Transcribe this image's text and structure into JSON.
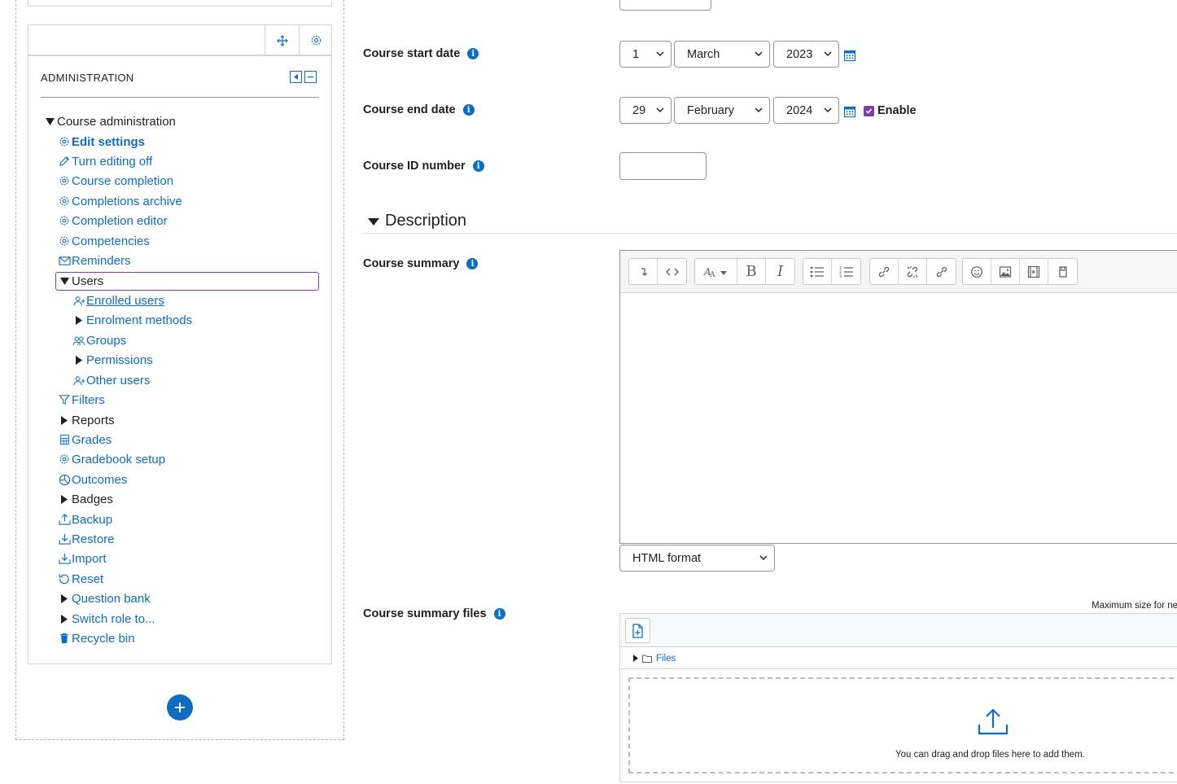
{
  "sidebar": {
    "block_title": "ADMINISTRATION",
    "items": [
      {
        "label": "Course administration",
        "kind": "expanded-plain"
      },
      {
        "label": "Edit settings",
        "kind": "link-bold",
        "icon": "gear-icon"
      },
      {
        "label": "Turn editing off",
        "kind": "link",
        "icon": "pencil-icon"
      },
      {
        "label": "Course completion",
        "kind": "link",
        "icon": "gear-icon"
      },
      {
        "label": "Completions archive",
        "kind": "link",
        "icon": "gear-icon"
      },
      {
        "label": "Completion editor",
        "kind": "link",
        "icon": "gear-icon"
      },
      {
        "label": "Competencies",
        "kind": "link",
        "icon": "gear-icon"
      },
      {
        "label": "Reminders",
        "kind": "link",
        "icon": "envelope-icon"
      },
      {
        "label": "Users",
        "kind": "expanded-plain"
      },
      {
        "label": "Enrolled users",
        "kind": "link-underline",
        "icon": "user-plus-icon"
      },
      {
        "label": "Enrolment methods",
        "kind": "collapsed-link"
      },
      {
        "label": "Groups",
        "kind": "link",
        "icon": "users-icon"
      },
      {
        "label": "Permissions",
        "kind": "collapsed-link"
      },
      {
        "label": "Other users",
        "kind": "link",
        "icon": "user-plus-icon"
      },
      {
        "label": "Filters",
        "kind": "link",
        "icon": "filter-icon"
      },
      {
        "label": "Reports",
        "kind": "collapsed-plain"
      },
      {
        "label": "Grades",
        "kind": "link",
        "icon": "table-icon"
      },
      {
        "label": "Gradebook setup",
        "kind": "link",
        "icon": "gear-icon"
      },
      {
        "label": "Outcomes",
        "kind": "link",
        "icon": "pie-chart-icon"
      },
      {
        "label": "Badges",
        "kind": "collapsed-plain"
      },
      {
        "label": "Backup",
        "kind": "link",
        "icon": "upload-icon"
      },
      {
        "label": "Restore",
        "kind": "link",
        "icon": "download-icon"
      },
      {
        "label": "Import",
        "kind": "link",
        "icon": "download-icon"
      },
      {
        "label": "Reset",
        "kind": "link",
        "icon": "refresh-icon"
      },
      {
        "label": "Question bank",
        "kind": "collapsed-link"
      },
      {
        "label": "Switch role to...",
        "kind": "collapsed-link"
      },
      {
        "label": "Recycle bin",
        "kind": "link",
        "icon": "trash-icon"
      }
    ]
  },
  "form": {
    "start_date": {
      "label": "Course start date",
      "day": "1",
      "month": "March",
      "year": "2023"
    },
    "end_date": {
      "label": "Course end date",
      "day": "29",
      "month": "February",
      "year": "2024",
      "enable_label": "Enable",
      "enabled": true
    },
    "id_number": {
      "label": "Course ID number",
      "value": ""
    },
    "description_section": "Description",
    "summary": {
      "label": "Course summary",
      "format": "HTML format"
    },
    "summary_files": {
      "label": "Course summary files",
      "max_size_text": "Maximum size for ne",
      "path_label": "Files",
      "drop_text": "You can drag and drop files here to add them."
    }
  },
  "colors": {
    "link": "#0f6cbf",
    "checkbox": "#7b3fa5",
    "focus_outline": "#7b3fa5"
  }
}
